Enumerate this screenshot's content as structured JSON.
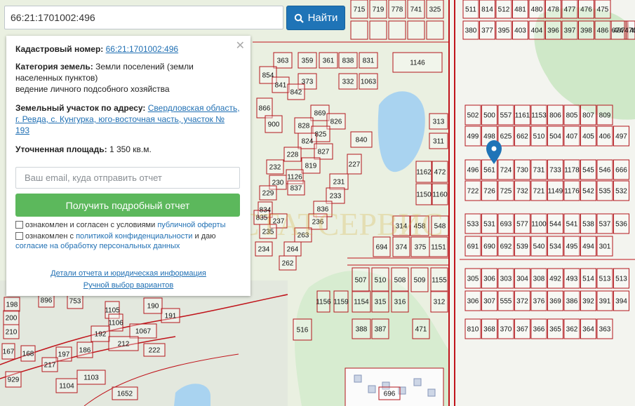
{
  "search": {
    "value": "66:21:1701002:496",
    "button_label": "Найти"
  },
  "panel": {
    "cad_label": "Кадастровый номер:",
    "cad_value": "66:21:1701002:496",
    "category_label": "Категория земель:",
    "category_value": "Земли поселений (земли населенных пунктов)",
    "usage": "ведение личного подсобного хозяйства",
    "address_label": "Земельный участок по адресу:",
    "address_value": "Свердловская область, г. Ревда, с. Кунгурка, юго-восточная часть, участок № 193",
    "area_label": "Уточненная площадь:",
    "area_value": "1 350 кв.м.",
    "email_placeholder": "Ваш email, куда отправить отчет",
    "order_button": "Получить подробный отчет",
    "check1_text": "ознакомлен и согласен с условиями ",
    "check1_link": "публичной оферты",
    "check2_text": "ознакомлен с ",
    "check2_link1": "политикой конфиденциальности",
    "check2_mid": " и даю",
    "check2_link2": "согласие на обработку персональных данных",
    "details_link": "Детали отчета и юридическая информация",
    "manual_link": "Ручной выбор вариантов",
    "close_icon": "close-icon"
  },
  "map": {
    "marker_icon": "map-pin-icon",
    "parcel_color": "#b3161c",
    "road_color": "#c0141b",
    "forest_color": "#cde6c5",
    "water_color": "#a9d3f0",
    "top_labels": [
      "715",
      "719",
      "778",
      "741",
      "325",
      "511",
      "814",
      "512",
      "481",
      "480",
      "478",
      "477",
      "476",
      "475",
      "380",
      "377",
      "395",
      "403",
      "404",
      "396",
      "397",
      "398",
      "486",
      "487",
      "488",
      "674",
      "476"
    ],
    "mid_labels": [
      "363",
      "359",
      "361",
      "838",
      "831",
      "1146",
      "373",
      "332",
      "1063",
      "854",
      "841",
      "842",
      "866",
      "900",
      "869",
      "826",
      "828",
      "825",
      "824",
      "827",
      "840",
      "228",
      "819",
      "232",
      "227",
      "1126",
      "231",
      "230",
      "837",
      "233",
      "229",
      "836",
      "834",
      "237",
      "236",
      "835",
      "263",
      "235",
      "264",
      "234",
      "262",
      "313",
      "311",
      "1162",
      "472",
      "1150",
      "1160"
    ],
    "grid_labels": [
      "502",
      "500",
      "557",
      "1161",
      "1153",
      "806",
      "805",
      "807",
      "809",
      "499",
      "498",
      "625",
      "662",
      "510",
      "504",
      "407",
      "405",
      "406",
      "497",
      "496",
      "561",
      "724",
      "730",
      "731",
      "733",
      "1178",
      "545",
      "546",
      "666",
      "722",
      "726",
      "725",
      "732",
      "721",
      "1149",
      "1176",
      "542",
      "535",
      "532",
      "533",
      "531",
      "693",
      "577",
      "1100",
      "544",
      "541",
      "538",
      "537",
      "536",
      "691",
      "690",
      "692",
      "539",
      "540",
      "534",
      "495",
      "494",
      "301",
      "305",
      "306",
      "303",
      "304",
      "308",
      "492",
      "493",
      "514",
      "513",
      "513",
      "306",
      "307",
      "555",
      "372",
      "376",
      "369",
      "386",
      "392",
      "391",
      "394",
      "810",
      "368",
      "370",
      "367",
      "366",
      "365",
      "362",
      "364",
      "363"
    ],
    "lower_labels": [
      "314",
      "548",
      "458",
      "694",
      "374",
      "375",
      "1151",
      "507",
      "510",
      "508",
      "509",
      "1155",
      "1154",
      "315",
      "316",
      "312",
      "1156",
      "1159",
      "516",
      "388",
      "387",
      "471",
      "696",
      "198",
      "896",
      "753",
      "1105",
      "190",
      "200",
      "191",
      "1106",
      "210",
      "192",
      "1067",
      "168",
      "212",
      "222",
      "167",
      "197",
      "186",
      "217",
      "929",
      "1104",
      "1103",
      "1652"
    ]
  }
}
